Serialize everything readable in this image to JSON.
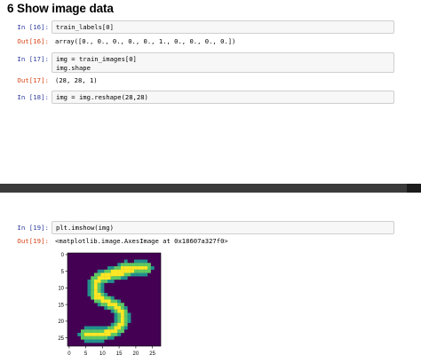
{
  "heading": "6 Show image data",
  "cells": [
    {
      "in_prompt": "In [16]:",
      "code": "train_labels[0]",
      "out_prompt": "Out[16]:",
      "output": "array([0., 0., 0., 0., 0., 1., 0., 0., 0., 0.])"
    },
    {
      "in_prompt": "In [17]:",
      "code": "img = train_images[0]\nimg.shape",
      "out_prompt": "Out[17]:",
      "output": "(28, 28, 1)"
    },
    {
      "in_prompt": "In [18]:",
      "code": "img = img.reshape(28,28)"
    },
    {
      "in_prompt": "In [19]:",
      "code": "plt.imshow(img)",
      "out_prompt": "Out[19]:",
      "output": "<matplotlib.image.AxesImage at 0x18607a327f0>"
    }
  ],
  "plot": {
    "background_color": "#440154",
    "colormap": [
      "#440154",
      "#3b528b",
      "#21918c",
      "#5ec962",
      "#fde725"
    ],
    "y_ticks": [
      "0",
      "5",
      "10",
      "15",
      "20",
      "25"
    ],
    "x_ticks": [
      "0",
      "5",
      "10",
      "15",
      "20",
      "25"
    ]
  }
}
